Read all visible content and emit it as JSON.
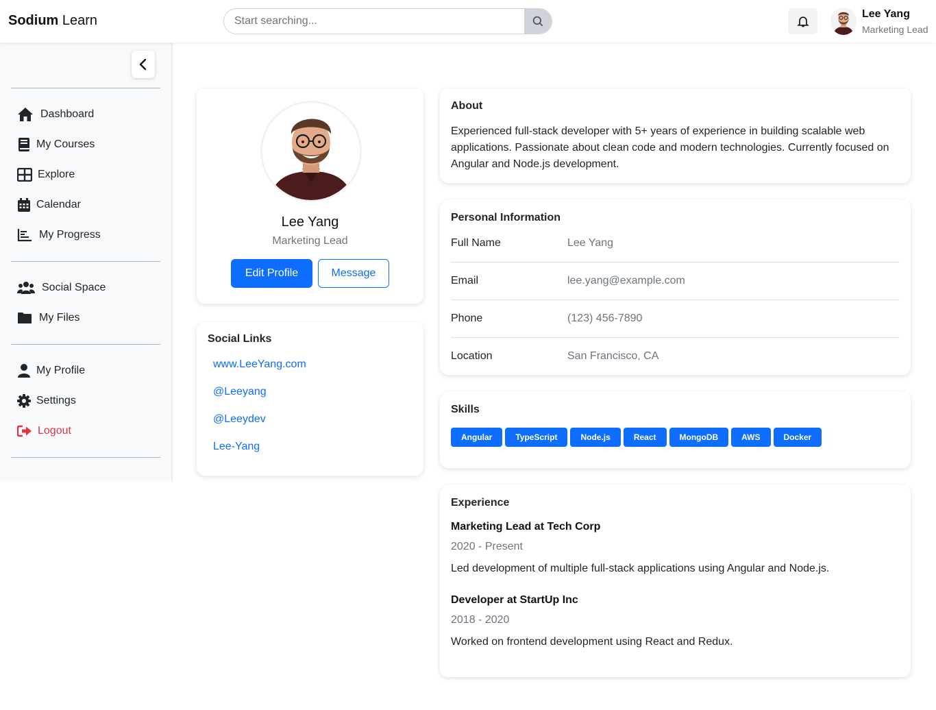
{
  "brand": {
    "bold": "Sodium",
    "light": "Learn"
  },
  "search": {
    "placeholder": "Start searching..."
  },
  "user": {
    "name": "Lee Yang",
    "role": "Marketing Lead"
  },
  "sidebar": {
    "main": [
      {
        "label": "Dashboard",
        "icon": "home-icon"
      },
      {
        "label": "My Courses",
        "icon": "book-icon"
      },
      {
        "label": "Explore",
        "icon": "grid-icon"
      },
      {
        "label": "Calendar",
        "icon": "calendar-icon"
      },
      {
        "label": "My Progress",
        "icon": "chart-icon"
      }
    ],
    "social": [
      {
        "label": "Social Space",
        "icon": "users-icon"
      },
      {
        "label": "My Files",
        "icon": "folder-icon"
      }
    ],
    "account": [
      {
        "label": "My Profile",
        "icon": "user-icon"
      },
      {
        "label": "Settings",
        "icon": "gear-icon"
      },
      {
        "label": "Logout",
        "icon": "logout-icon"
      }
    ]
  },
  "profile": {
    "name": "Lee Yang",
    "role": "Marketing Lead",
    "edit_label": "Edit Profile",
    "message_label": "Message"
  },
  "social_links": {
    "title": "Social Links",
    "links": [
      "www.LeeYang.com",
      "@Leeyang",
      "@Leeydev",
      "Lee-Yang"
    ]
  },
  "about": {
    "title": "About",
    "text": "Experienced full-stack developer with 5+ years of experience in building scalable web applications. Passionate about clean code and modern technologies. Currently focused on Angular and Node.js development."
  },
  "personal_info": {
    "title": "Personal Information",
    "rows": [
      {
        "label": "Full Name",
        "value": "Lee Yang"
      },
      {
        "label": "Email",
        "value": "lee.yang@example.com"
      },
      {
        "label": "Phone",
        "value": "(123) 456-7890"
      },
      {
        "label": "Location",
        "value": "San Francisco, CA"
      }
    ]
  },
  "skills": {
    "title": "Skills",
    "items": [
      "Angular",
      "TypeScript",
      "Node.js",
      "React",
      "MongoDB",
      "AWS",
      "Docker"
    ]
  },
  "experience": {
    "title": "Experience",
    "items": [
      {
        "title": "Marketing Lead at Tech Corp",
        "years": "2020 - Present",
        "desc": "Led development of multiple full-stack applications using Angular and Node.js."
      },
      {
        "title": "Developer at StartUp Inc",
        "years": "2018 - 2020",
        "desc": "Worked on frontend development using React and Redux."
      }
    ]
  },
  "colors": {
    "primary": "#0d6efd",
    "danger": "#dc3545",
    "muted": "#6c757d"
  }
}
